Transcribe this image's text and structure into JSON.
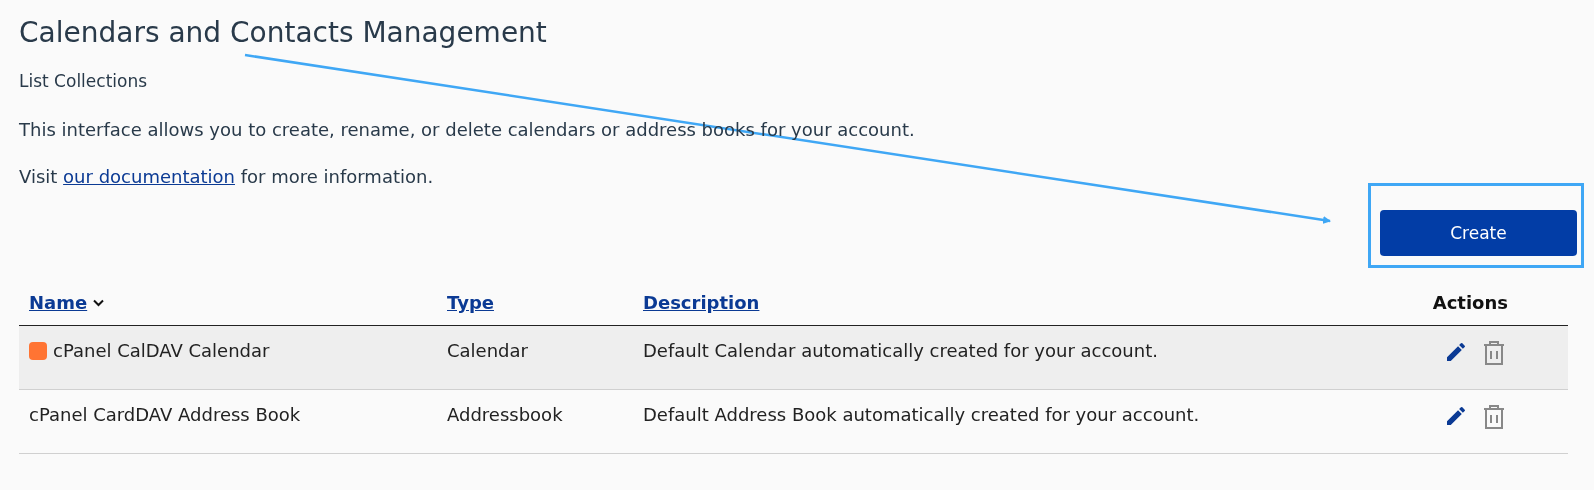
{
  "page": {
    "title": "Calendars and Contacts Management",
    "subtitle": "List Collections",
    "intro": "This interface allows you to create, rename, or delete calendars or address books for your account.",
    "doc_before": "Visit",
    "doc_link": "our documentation",
    "doc_after": "for more information."
  },
  "create_button": {
    "label": "Create",
    "highlighted": true
  },
  "table": {
    "columns": [
      {
        "label": "Name",
        "sortable": true,
        "sorted": true
      },
      {
        "label": "Type",
        "sortable": true,
        "sorted": false
      },
      {
        "label": "Description",
        "sortable": true,
        "sorted": false
      },
      {
        "label": "Actions",
        "sortable": false,
        "sorted": false
      }
    ],
    "rows": [
      {
        "name": "cPanel CalDAV Calendar",
        "color": "#ff7433",
        "type": "Calendar",
        "description": "Default Calendar automatically created for your account.",
        "highlighted": true
      },
      {
        "name": "cPanel CardDAV Address Book",
        "type": "Addressbook",
        "description": "Default Address Book automatically created for your account.",
        "highlighted": false
      }
    ]
  }
}
